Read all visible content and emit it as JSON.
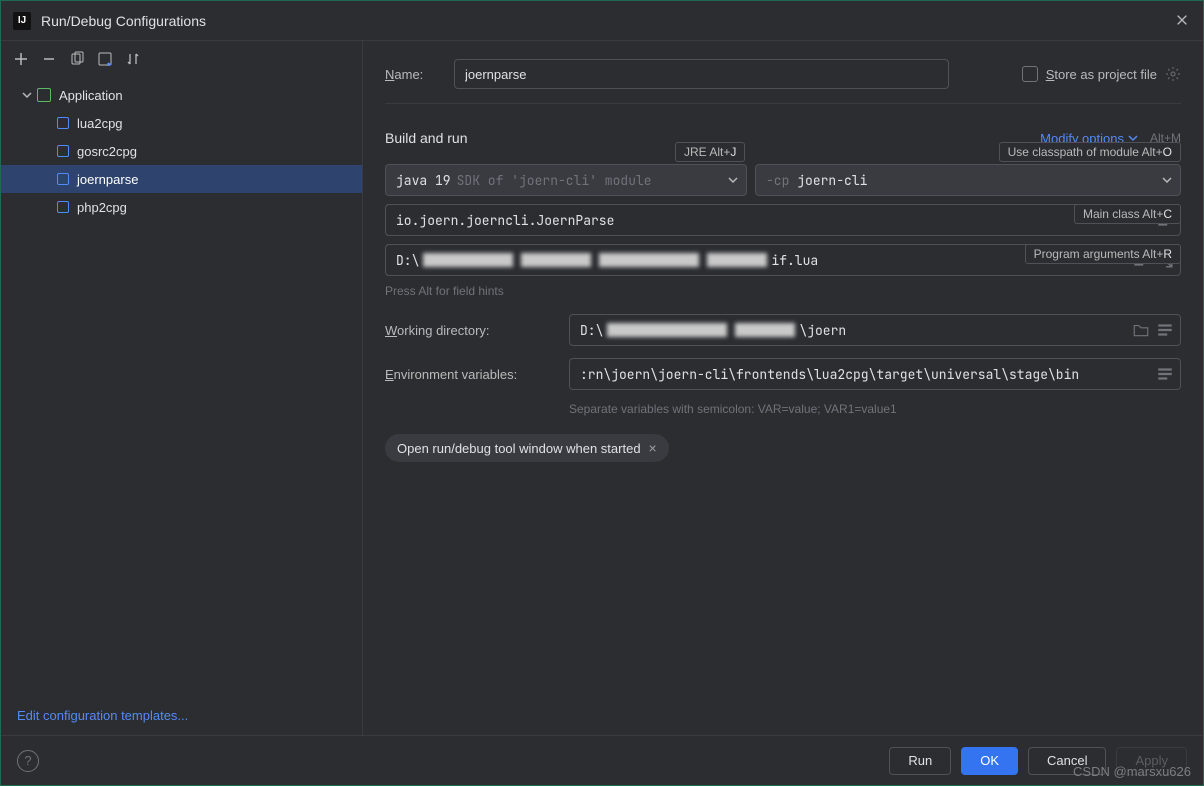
{
  "window": {
    "title": "Run/Debug Configurations"
  },
  "tree": {
    "root": "Application",
    "items": [
      "lua2cpg",
      "gosrc2cpg",
      "joernparse",
      "php2cpg"
    ],
    "selected_index": 2
  },
  "name": {
    "label": "Name:",
    "value": "joernparse"
  },
  "store": {
    "label": "Store as project file"
  },
  "build": {
    "title": "Build and run",
    "modify": "Modify options",
    "modify_shortcut": "Alt+M",
    "jre_hint": "JRE Alt+",
    "jre_hint_key": "J",
    "classpath_hint": "Use classpath of module Alt+",
    "classpath_hint_key": "O",
    "jre_value": "java 19",
    "jre_dim": "SDK of 'joern-cli' module",
    "cp_prefix": "-cp",
    "cp_value": "joern-cli",
    "mainclass_hint": "Main class Alt+",
    "mainclass_hint_key": "C",
    "mainclass_value": "io.joern.joerncli.JoernParse",
    "progargs_hint": "Program arguments Alt+",
    "progargs_hint_key": "R",
    "progargs_prefix": "D:\\",
    "progargs_suffix": "if.lua",
    "hint_text": "Press Alt for field hints"
  },
  "workdir": {
    "label": "Working directory:",
    "prefix": "D:\\",
    "suffix": "\\joern"
  },
  "env": {
    "label": "Environment variables:",
    "value": ":rn\\joern\\joern-cli\\frontends\\lua2cpg\\target\\universal\\stage\\bin",
    "hint": "Separate variables with semicolon: VAR=value; VAR1=value1"
  },
  "chip": {
    "label": "Open run/debug tool window when started"
  },
  "sidebar_footer": "Edit configuration templates...",
  "buttons": {
    "run": "Run",
    "ok": "OK",
    "cancel": "Cancel",
    "apply": "Apply"
  },
  "watermark": "CSDN @marsxu626"
}
